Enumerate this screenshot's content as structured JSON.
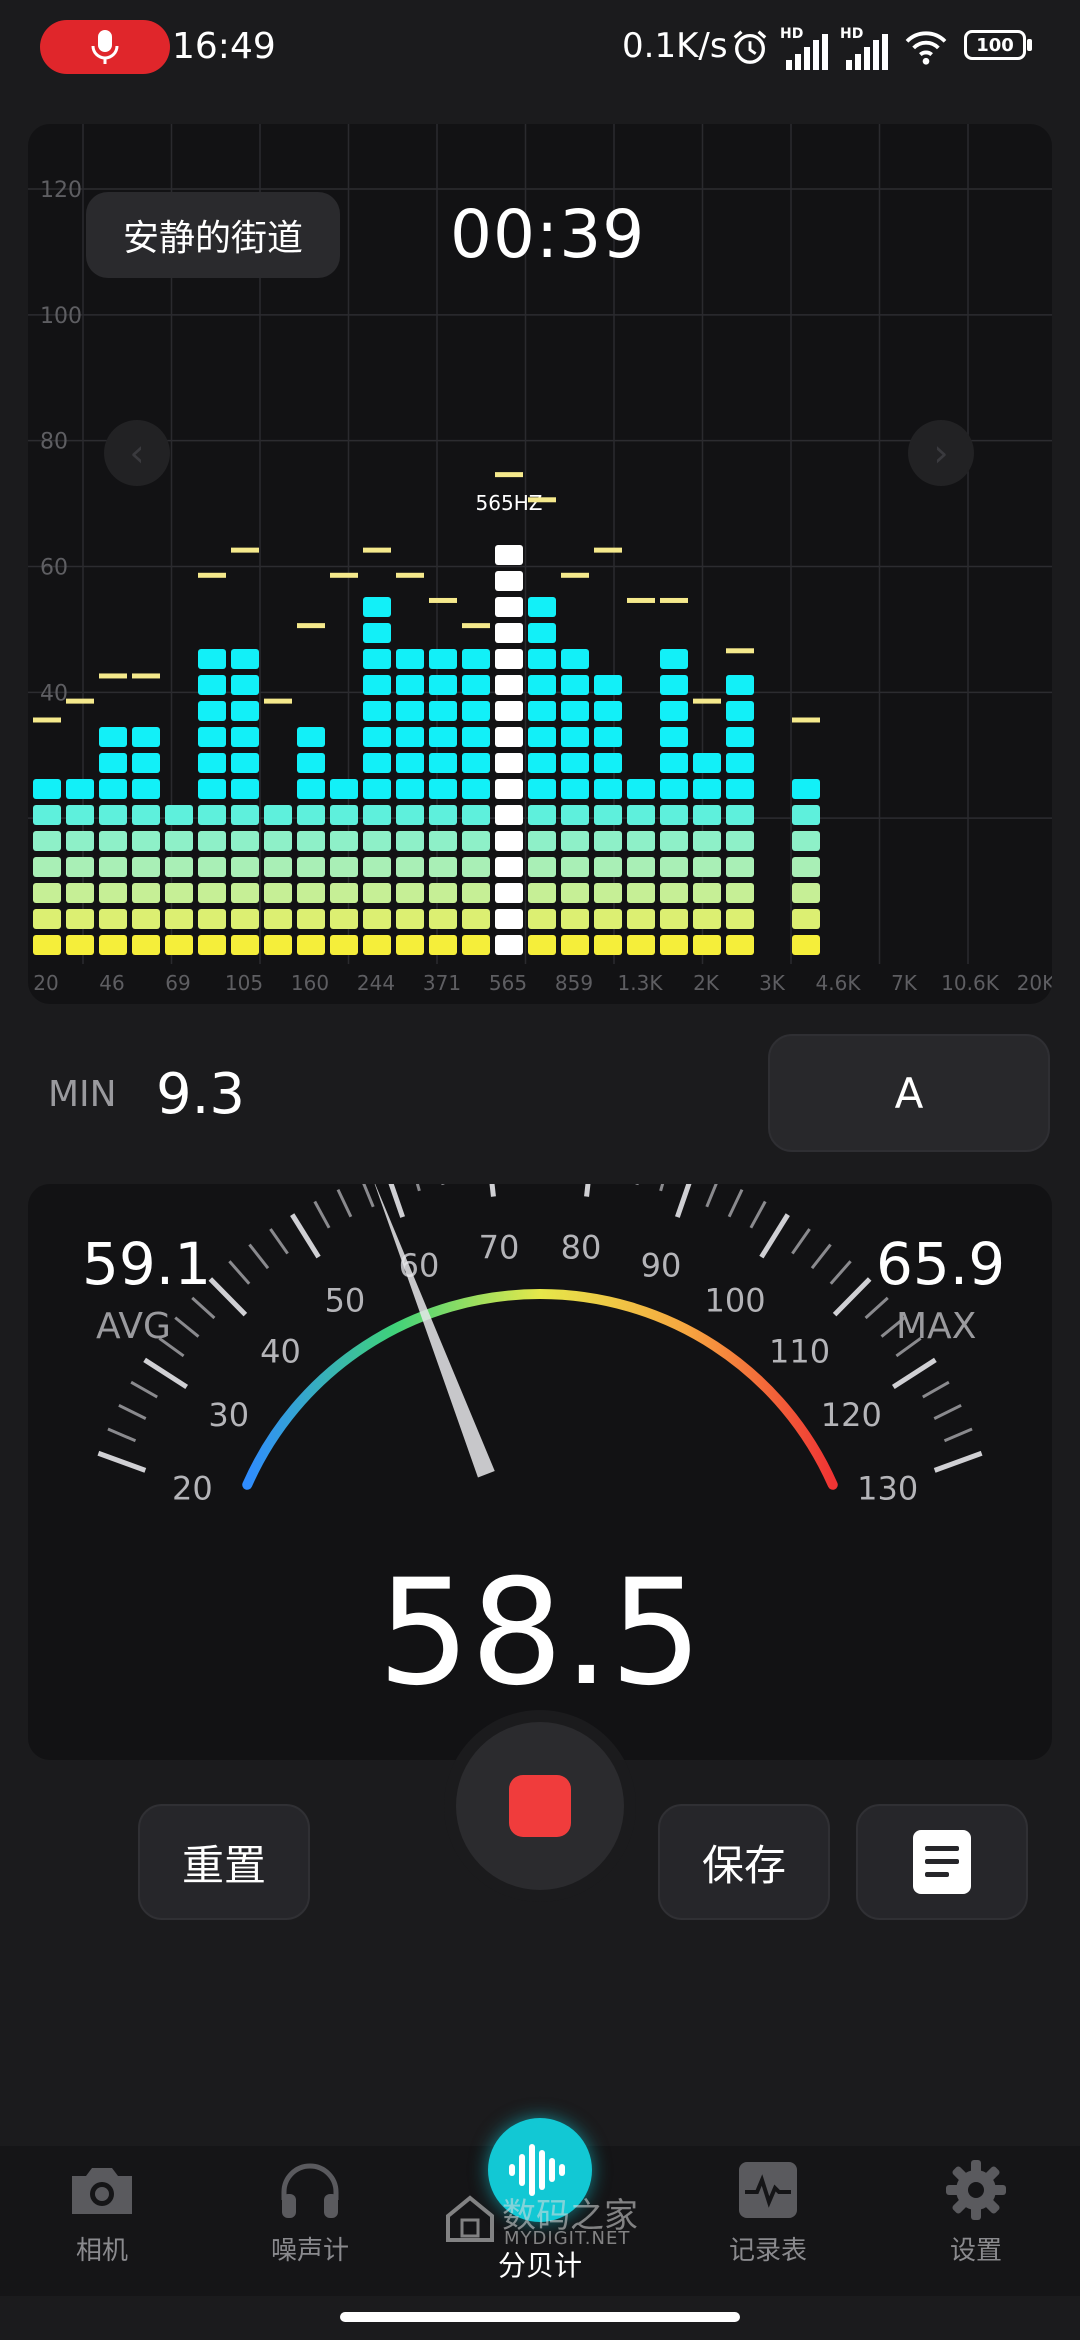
{
  "status_bar": {
    "time": "16:49",
    "net_speed": "0.1K/s",
    "battery": "100",
    "signal_tag": "HD"
  },
  "spectrum": {
    "scene_label": "安静的街道",
    "timer": "00:39",
    "highlight_label": "565HZ"
  },
  "chart_data": {
    "type": "bar",
    "y_ticks": [
      "120",
      "100",
      "80",
      "60",
      "40"
    ],
    "x_ticks": [
      "20",
      "46",
      "69",
      "105",
      "160",
      "244",
      "371",
      "565",
      "859",
      "1.3K",
      "2K",
      "3K",
      "4.6K",
      "7K",
      "10.6K",
      "20K"
    ],
    "ylim": [
      0,
      120
    ],
    "grid": true,
    "segments_per_bar": [
      7,
      7,
      9,
      9,
      6,
      12,
      12,
      6,
      9,
      7,
      14,
      12,
      12,
      12,
      16,
      14,
      12,
      11,
      7,
      12,
      8,
      11,
      0,
      7
    ],
    "peak_levels": [
      36,
      39,
      43,
      43,
      0,
      59,
      63,
      39,
      51,
      59,
      63,
      59,
      55,
      51,
      75,
      71,
      59,
      63,
      55,
      55,
      39,
      47,
      0,
      36
    ],
    "highlight_index": 14,
    "colors": {
      "bar_top": "#12f0f8",
      "bar_mid": "#8ef0c8",
      "bar_bottom": "#f5ee3a",
      "highlight": "#ffffff",
      "peak": "#f5e98c"
    }
  },
  "weight": {
    "min_label": "MIN",
    "min_value": "9.3",
    "mode": "A"
  },
  "gauge": {
    "avg_value": "59.1",
    "avg_label": "AVG",
    "max_value": "65.9",
    "max_label": "MAX",
    "current_value": "58.5",
    "scale_min": 20,
    "scale_max": 130,
    "needle_value": 58.5,
    "scale_labels": [
      "20",
      "30",
      "40",
      "50",
      "60",
      "70",
      "80",
      "90",
      "100",
      "110",
      "120",
      "130"
    ]
  },
  "controls": {
    "reset_label": "重置",
    "save_label": "保存"
  },
  "bottom_nav": {
    "items": [
      {
        "label": "相机",
        "icon": "camera-icon"
      },
      {
        "label": "噪声计",
        "icon": "headphones-icon"
      },
      {
        "label": "分贝计",
        "icon": "soundwave-icon"
      },
      {
        "label": "记录表",
        "icon": "chart-record-icon"
      },
      {
        "label": "设置",
        "icon": "gear-icon"
      }
    ]
  },
  "watermark": {
    "text": "数码之家",
    "sub": "MYDIGIT.NET"
  }
}
